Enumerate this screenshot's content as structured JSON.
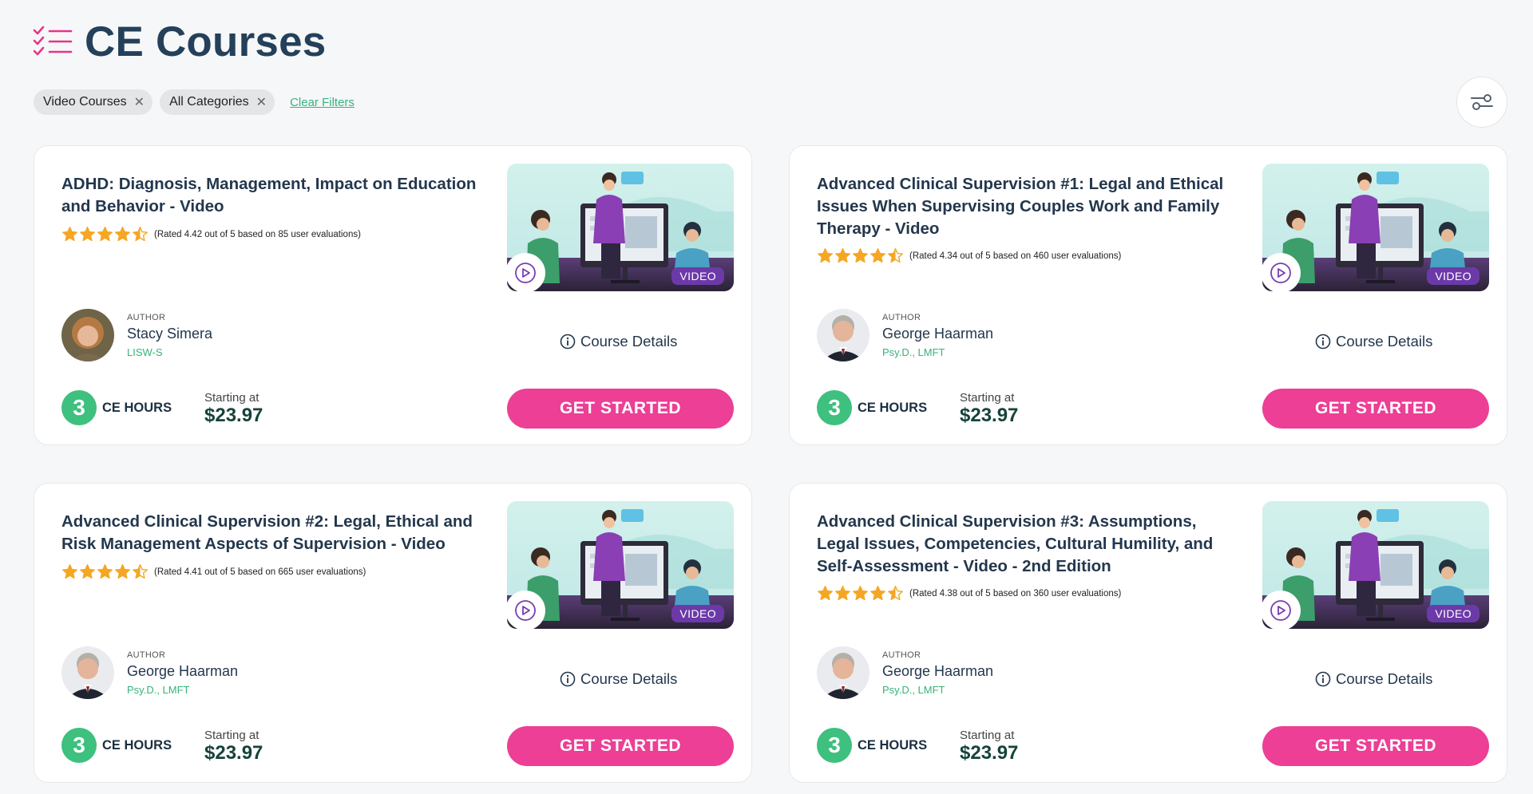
{
  "header": {
    "title": "CE Courses"
  },
  "filters": {
    "chips": [
      {
        "label": "Video Courses"
      },
      {
        "label": "All Categories"
      }
    ],
    "clear_label": "Clear Filters"
  },
  "courses": [
    {
      "title": "ADHD: Diagnosis, Management, Impact on Education and Behavior - Video",
      "rating_value": 4.42,
      "rating_text": "(Rated 4.42 out of 5 based on 85 user evaluations)",
      "badge": "VIDEO",
      "author_label": "AUTHOR",
      "author_name": "Stacy Simera",
      "author_credentials": "LISW-S",
      "details_label": "Course Details",
      "ce_hours": "3",
      "ce_hours_label": "CE HOURS",
      "price_label": "Starting at",
      "price": "$23.97",
      "cta_label": "GET STARTED"
    },
    {
      "title": "Advanced Clinical Supervision #1: Legal and Ethical Issues When Supervising Couples Work and Family Therapy - Video",
      "rating_value": 4.34,
      "rating_text": "(Rated 4.34 out of 5 based on 460 user evaluations)",
      "badge": "VIDEO",
      "author_label": "AUTHOR",
      "author_name": "George Haarman",
      "author_credentials": "Psy.D., LMFT",
      "details_label": "Course Details",
      "ce_hours": "3",
      "ce_hours_label": "CE HOURS",
      "price_label": "Starting at",
      "price": "$23.97",
      "cta_label": "GET STARTED"
    },
    {
      "title": "Advanced Clinical Supervision #2: Legal, Ethical and Risk Management Aspects of Supervision - Video",
      "rating_value": 4.41,
      "rating_text": "(Rated 4.41 out of 5 based on 665 user evaluations)",
      "badge": "VIDEO",
      "author_label": "AUTHOR",
      "author_name": "George Haarman",
      "author_credentials": "Psy.D., LMFT",
      "details_label": "Course Details",
      "ce_hours": "3",
      "ce_hours_label": "CE HOURS",
      "price_label": "Starting at",
      "price": "$23.97",
      "cta_label": "GET STARTED"
    },
    {
      "title": "Advanced Clinical Supervision #3: Assumptions, Legal Issues, Competencies, Cultural Humility, and Self-Assessment - Video - 2nd Edition",
      "rating_value": 4.38,
      "rating_text": "(Rated 4.38 out of 5 based on 360 user evaluations)",
      "badge": "VIDEO",
      "author_label": "AUTHOR",
      "author_name": "George Haarman",
      "author_credentials": "Psy.D., LMFT",
      "details_label": "Course Details",
      "ce_hours": "3",
      "ce_hours_label": "CE HOURS",
      "price_label": "Starting at",
      "price": "$23.97",
      "cta_label": "GET STARTED"
    }
  ],
  "colors": {
    "accent_pink": "#ec3f95",
    "accent_green": "#3ec07e",
    "title_navy": "#24405a",
    "star_gold": "#f5a623",
    "badge_purple": "#6c3aa8"
  },
  "icons": [
    "checklist-icon",
    "close-icon",
    "filter-settings-icon",
    "star-icon",
    "play-icon",
    "info-icon"
  ]
}
